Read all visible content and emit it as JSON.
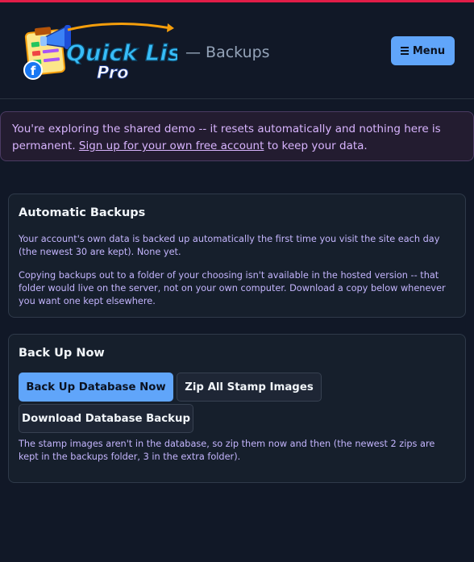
{
  "header": {
    "logo_text_line1": "Quick List",
    "logo_text_line2": "Pro",
    "page_title": "— Backups",
    "menu_label": "Menu",
    "menu_icon": "hamburger-icon"
  },
  "demo_banner": {
    "text_before": "You're exploring the shared demo -- it resets automatically and nothing here is permanent. ",
    "link_text": "Sign up for your own free account",
    "text_after": " to keep your data."
  },
  "automatic_backups": {
    "title": "Automatic Backups",
    "paragraph1": "Your account's own data is backed up automatically the first time you visit the site each day (the newest 30 are kept). None yet.",
    "paragraph2": "Copying backups out to a folder of your choosing isn't available in the hosted version -- that folder would live on the server, not on your own computer. Download a copy below whenever you want one kept elsewhere."
  },
  "back_up_now": {
    "title": "Back Up Now",
    "backup_db_label": "Back Up Database Now",
    "zip_stamps_label": "Zip All Stamp Images",
    "download_label": "Download Database Backup",
    "note": "The stamp images aren't in the database, so zip them now and then (the newest 2 zips are kept in the backups folder, 3 in the extra folder)."
  },
  "colors": {
    "accent": "#60a5fa",
    "top_stripe": "#e11d48",
    "banner_text": "#d8b4fe",
    "background": "#111827"
  }
}
